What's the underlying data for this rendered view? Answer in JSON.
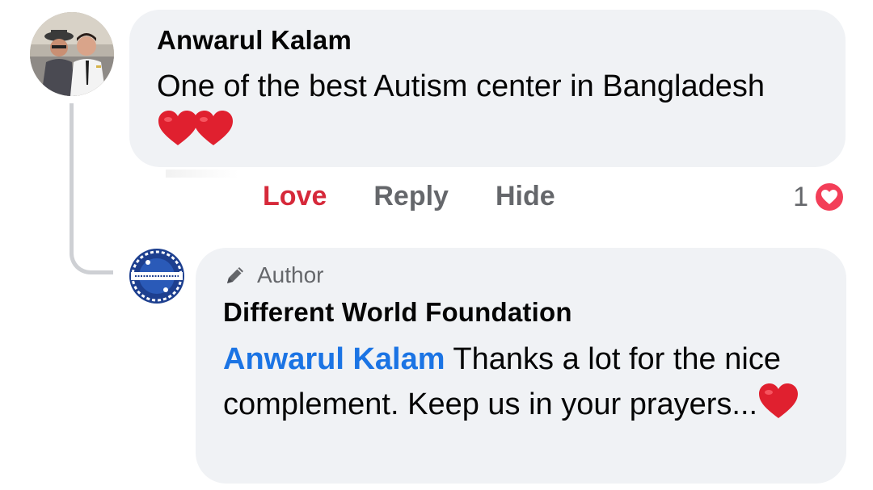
{
  "comment": {
    "author": "Anwarul Kalam",
    "text": "One of the best Autism center in Bangladesh",
    "emoji": [
      "red-heart",
      "red-heart"
    ],
    "actions": {
      "love": "Love",
      "reply": "Reply",
      "hide": "Hide"
    },
    "reaction_count": "1",
    "reaction_type": "love-icon"
  },
  "reply": {
    "badge": "Author",
    "author": "Different World Foundation",
    "mention": "Anwarul Kalam",
    "text": " Thanks a lot for the nice complement. Keep us in your prayers...",
    "emoji": [
      "red-heart"
    ]
  },
  "colors": {
    "bubble": "#f0f2f5",
    "love": "#d6293a",
    "mention": "#1b74e4",
    "muted": "#65676b",
    "reaction": "#f33e58"
  }
}
